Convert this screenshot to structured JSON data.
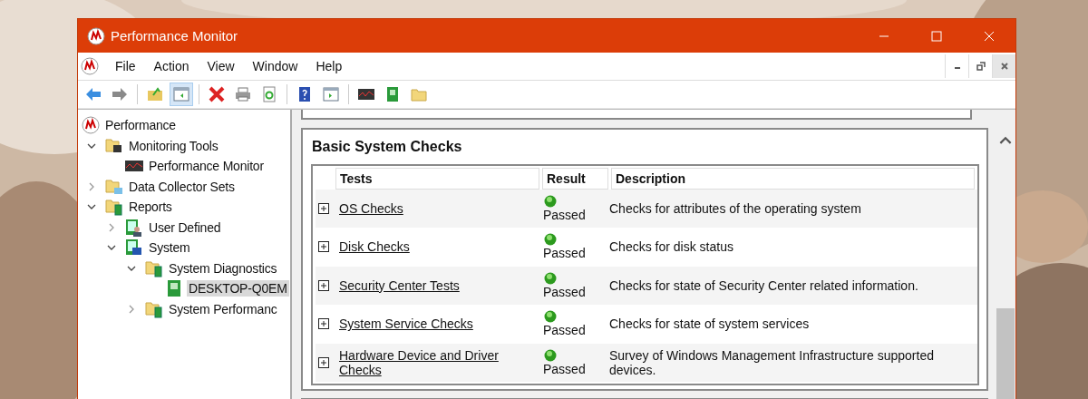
{
  "window": {
    "title": "Performance Monitor"
  },
  "menu": [
    "File",
    "Action",
    "View",
    "Window",
    "Help"
  ],
  "toolbar": {
    "console_tree_pressed": true
  },
  "tree": [
    {
      "label": "Performance",
      "kind": "root",
      "selected": false,
      "children": [
        {
          "label": "Monitoring Tools",
          "kind": "folder-tool",
          "expanded": true,
          "selected": false,
          "children": [
            {
              "label": "Performance Monitor",
              "kind": "monitor",
              "selected": false
            }
          ]
        },
        {
          "label": "Data Collector Sets",
          "kind": "folder-data",
          "expanded": false,
          "selected": false
        },
        {
          "label": "Reports",
          "kind": "folder-report",
          "expanded": true,
          "selected": false,
          "children": [
            {
              "label": "User Defined",
              "kind": "report-user",
              "expanded": false,
              "selected": false
            },
            {
              "label": "System",
              "kind": "report-system",
              "expanded": true,
              "selected": false,
              "children": [
                {
                  "label": "System Diagnostics",
                  "kind": "folder-report",
                  "expanded": true,
                  "selected": false,
                  "children": [
                    {
                      "label": "DESKTOP-Q0EM",
                      "kind": "report",
                      "selected": true
                    }
                  ]
                },
                {
                  "label": "System Performanc",
                  "kind": "folder-report",
                  "expanded": false,
                  "selected": false
                }
              ]
            }
          ]
        }
      ]
    }
  ],
  "section": {
    "title": "Basic System Checks",
    "columns": [
      "Tests",
      "Result",
      "Description"
    ],
    "rows": [
      {
        "test": "OS Checks",
        "result": "Passed",
        "description": "Checks for attributes of the operating system"
      },
      {
        "test": "Disk Checks",
        "result": "Passed",
        "description": "Checks for disk status"
      },
      {
        "test": "Security Center Tests",
        "result": "Passed",
        "description": "Checks for state of Security Center related information."
      },
      {
        "test": "System Service Checks",
        "result": "Passed",
        "description": "Checks for state of system services"
      },
      {
        "test": "Hardware Device and Driver Checks",
        "result": "Passed",
        "description": "Survey of Windows Management Infrastructure supported devices."
      }
    ]
  }
}
